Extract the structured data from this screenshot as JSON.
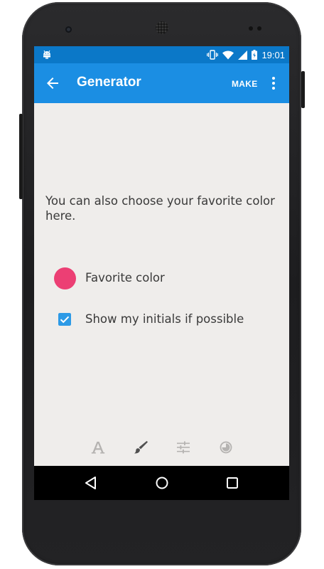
{
  "status_bar": {
    "time": "19:01"
  },
  "app_bar": {
    "title": "Generator",
    "make_label": "MAKE"
  },
  "content": {
    "description": "You can also choose your favorite color here.",
    "favorite_color_label": "Favorite color",
    "favorite_color": "#ec3f74",
    "initials_label": "Show my initials if possible",
    "initials_checked": true
  },
  "toolbar": {
    "items": [
      "text-icon",
      "brush-icon",
      "sliders-icon",
      "shape-icon"
    ],
    "selected": "brush-icon"
  },
  "nav_bar": {
    "items": [
      "back-triangle-icon",
      "home-circle-icon",
      "recents-square-icon"
    ]
  },
  "colors": {
    "status_bar": "#0b78c8",
    "app_bar": "#1b8ee3",
    "background": "#efedeb",
    "checkbox": "#2d9ae6"
  }
}
